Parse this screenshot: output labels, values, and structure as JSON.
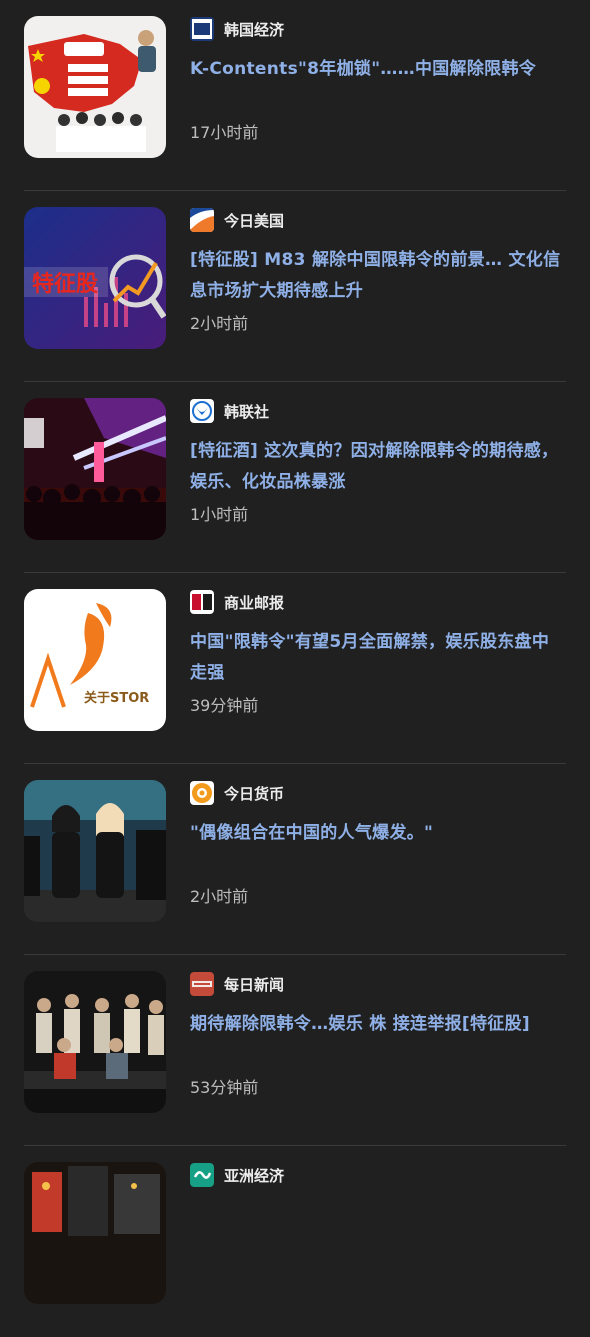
{
  "feed": {
    "items": [
      {
        "source": "韩国经济",
        "source_logo": "hankyung-logo-icon",
        "headline": "K-Contents\"8年枷锁\"……中国解除限韩令",
        "time": "17小时前",
        "thumbnail": "china-map-kpop-thumbnail"
      },
      {
        "source": "今日美国",
        "source_logo": "usa-today-logo-icon",
        "headline": "[特征股] M83 解除中国限韩令的前景… 文化信息市场扩大期待感上升",
        "time": "2小时前",
        "thumbnail": "stock-chart-thumbnail",
        "thumbnail_label": "特征股"
      },
      {
        "source": "韩联社",
        "source_logo": "yonhap-logo-icon",
        "headline": "[特征酒] 这次真的？因对解除限韩令的期待感，娱乐、化妆品株暴涨",
        "time": "1小时前",
        "thumbnail": "concert-stage-thumbnail"
      },
      {
        "source": "商业邮报",
        "source_logo": "business-post-logo-icon",
        "headline": "中国\"限韩令\"有望5月全面解禁，娱乐股东盘中走强",
        "time": "39分钟前",
        "thumbnail": "wing-logo-thumbnail",
        "thumbnail_label": "关于STOR"
      },
      {
        "source": "今日货币",
        "source_logo": "money-today-logo-icon",
        "headline": "\"偶像组合在中国的人气爆发。\"",
        "time": "2小时前",
        "thumbnail": "idol-group-thumbnail"
      },
      {
        "source": "每日新闻",
        "source_logo": "maeil-logo-icon",
        "headline": "期待解除限韩令…娱乐 株 接连举报[特征股]",
        "time": "53分钟前",
        "thumbnail": "dance-group-thumbnail"
      },
      {
        "source": "亚洲经济",
        "source_logo": "asia-economy-logo-icon",
        "headline": "",
        "time": "",
        "thumbnail": "city-night-thumbnail"
      }
    ]
  }
}
